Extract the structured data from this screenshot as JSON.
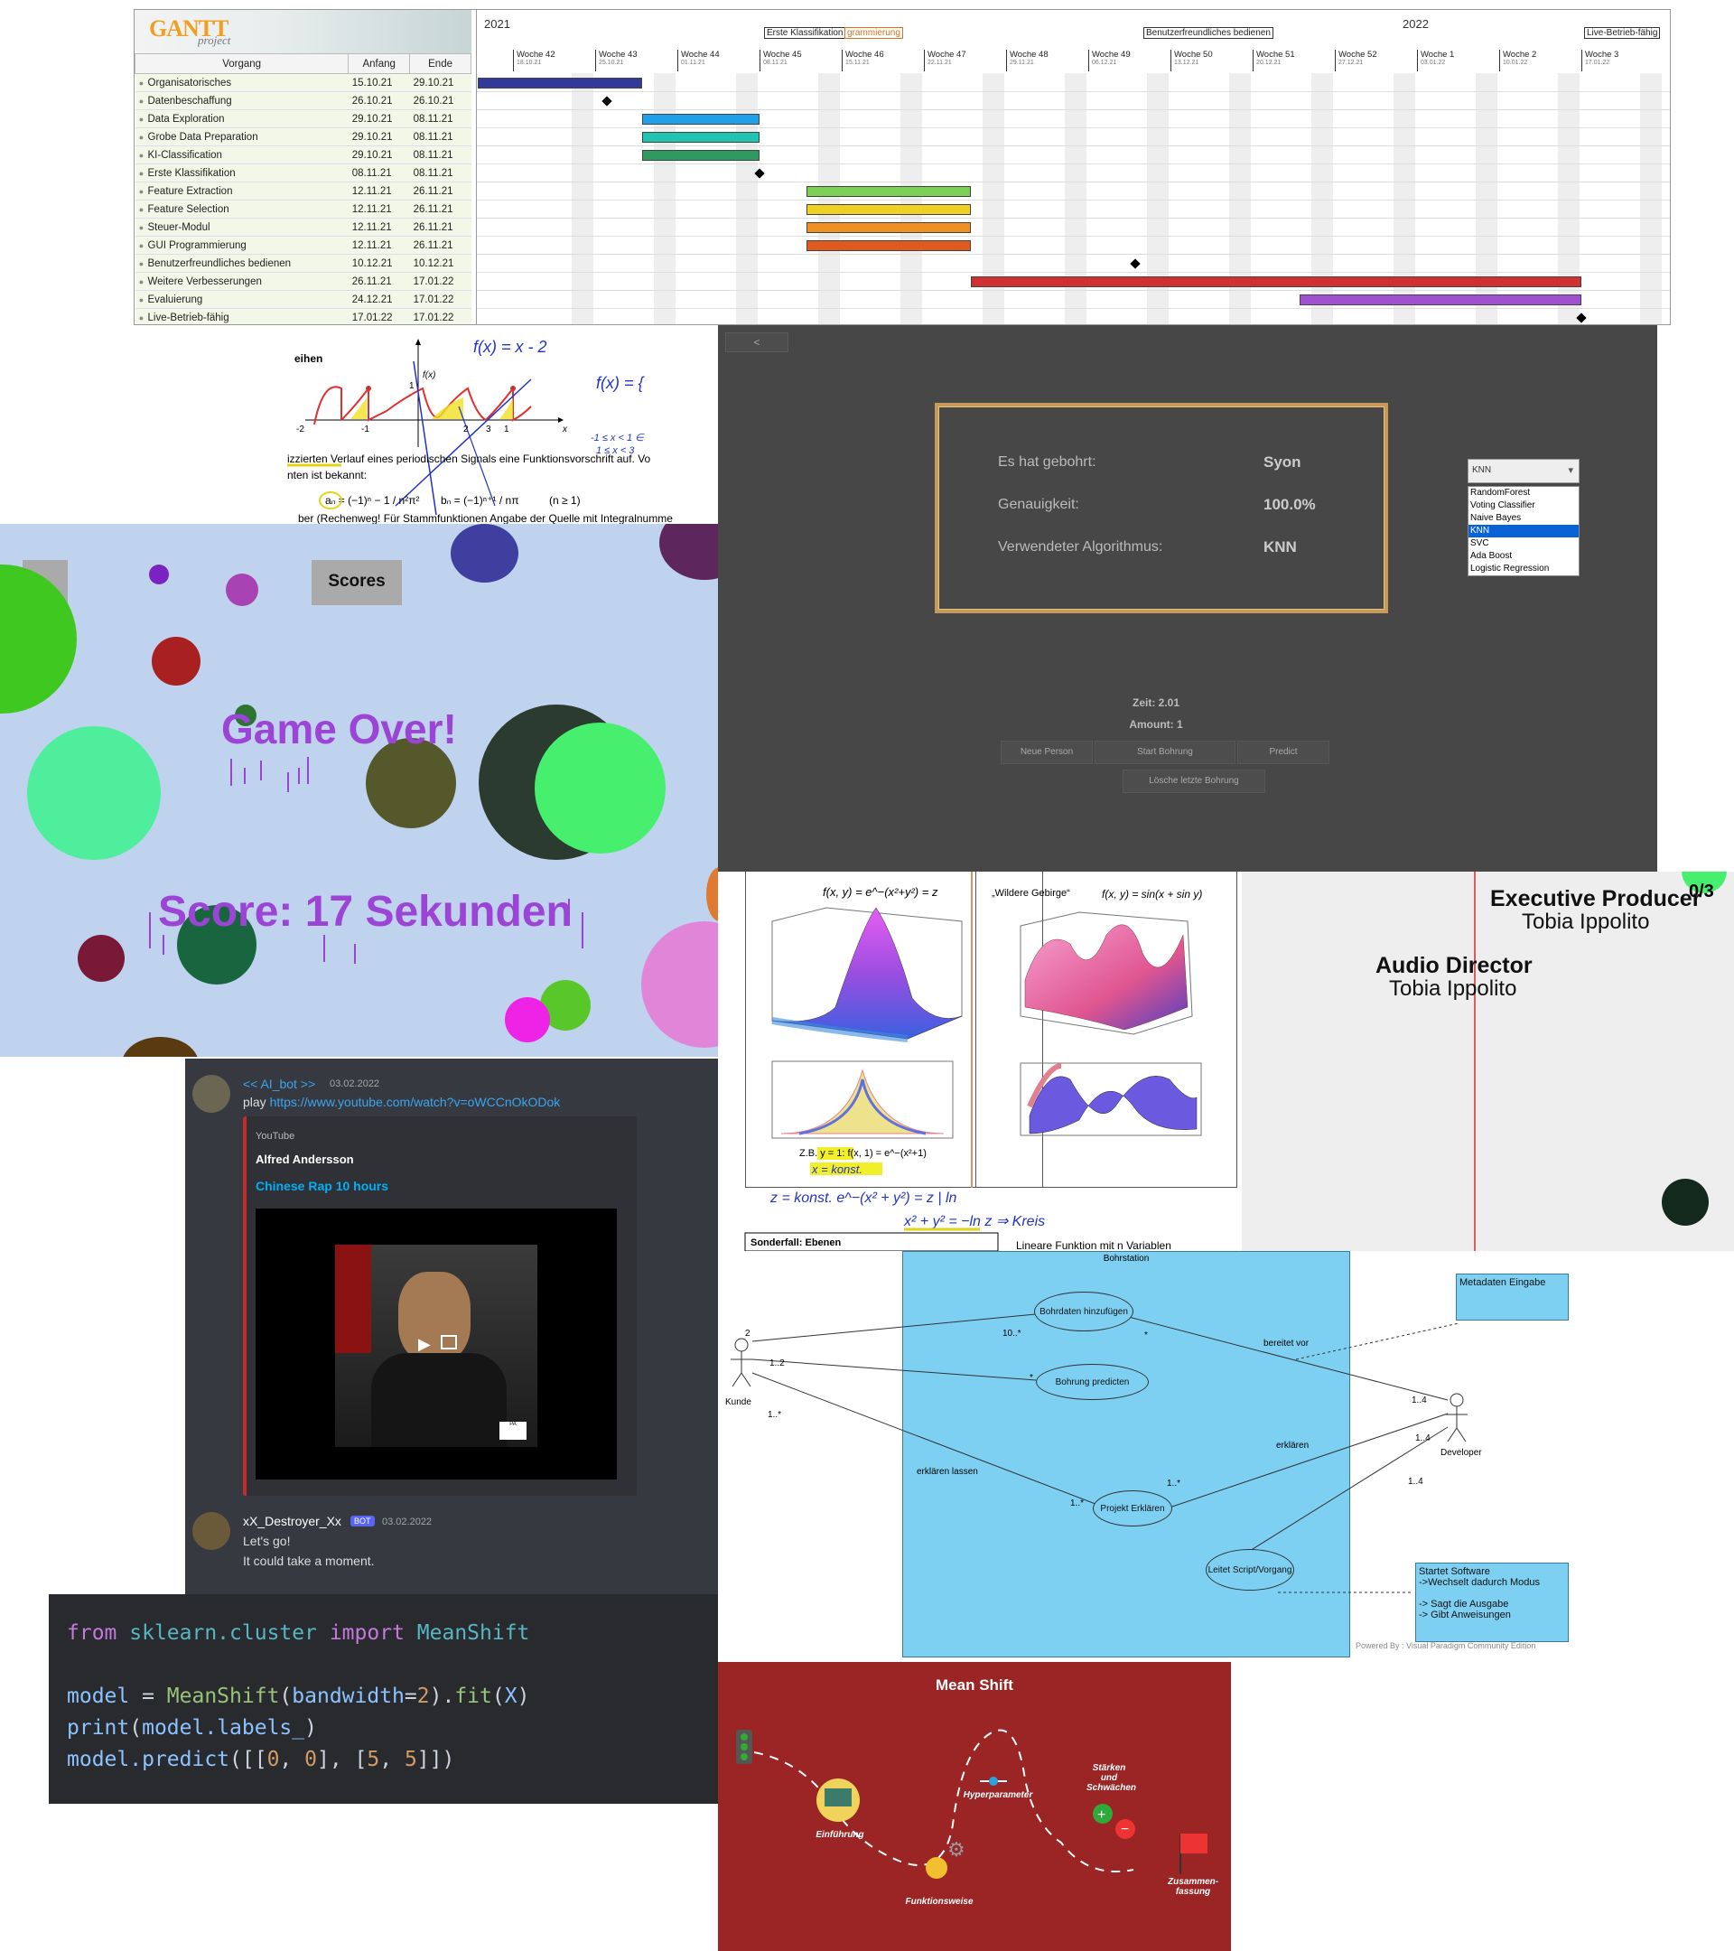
{
  "gantt": {
    "logo_text": "GANTT",
    "logo_sub": "project",
    "headers": [
      "Vorgang",
      "Anfang",
      "Ende"
    ],
    "tasks": [
      {
        "name": "Organisatorisches",
        "start": "15.10.21",
        "end": "29.10.21"
      },
      {
        "name": "Datenbeschaffung",
        "start": "26.10.21",
        "end": "26.10.21"
      },
      {
        "name": "Data Exploration",
        "start": "29.10.21",
        "end": "08.11.21"
      },
      {
        "name": "Grobe Data Preparation",
        "start": "29.10.21",
        "end": "08.11.21"
      },
      {
        "name": "KI-Classification",
        "start": "29.10.21",
        "end": "08.11.21"
      },
      {
        "name": "Erste Klassifikation",
        "start": "08.11.21",
        "end": "08.11.21"
      },
      {
        "name": "Feature Extraction",
        "start": "12.11.21",
        "end": "26.11.21"
      },
      {
        "name": "Feature Selection",
        "start": "12.11.21",
        "end": "26.11.21"
      },
      {
        "name": "Steuer-Modul",
        "start": "12.11.21",
        "end": "26.11.21"
      },
      {
        "name": "GUI Programmierung",
        "start": "12.11.21",
        "end": "26.11.21"
      },
      {
        "name": "Benutzerfreundliches bedienen",
        "start": "10.12.21",
        "end": "10.12.21"
      },
      {
        "name": "Weitere Verbesserungen",
        "start": "26.11.21",
        "end": "17.01.22"
      },
      {
        "name": "Evaluierung",
        "start": "24.12.21",
        "end": "17.01.22"
      },
      {
        "name": "Live-Betrieb-fähig",
        "start": "17.01.22",
        "end": "17.01.22"
      }
    ],
    "years": [
      "2021",
      "2022"
    ],
    "milestones": [
      "Erste Klassifikation",
      "grammierung",
      "Benutzerfreundliches bedienen",
      "Live-Betrieb-fähig"
    ],
    "weeks": [
      {
        "label": "Woche 42",
        "date": "18.10.21"
      },
      {
        "label": "Woche 43",
        "date": "25.10.21"
      },
      {
        "label": "Woche 44",
        "date": "01.11.21"
      },
      {
        "label": "Woche 45",
        "date": "08.11.21"
      },
      {
        "label": "Woche 46",
        "date": "15.11.21"
      },
      {
        "label": "Woche 47",
        "date": "22.11.21"
      },
      {
        "label": "Woche 48",
        "date": "29.11.21"
      },
      {
        "label": "Woche 49",
        "date": "06.12.21"
      },
      {
        "label": "Woche 50",
        "date": "13.12.21"
      },
      {
        "label": "Woche 51",
        "date": "20.12.21"
      },
      {
        "label": "Woche 52",
        "date": "27.12.21"
      },
      {
        "label": "Woche 1",
        "date": "03.01.22"
      },
      {
        "label": "Woche 2",
        "date": "10.01.22"
      },
      {
        "label": "Woche 3",
        "date": "17.01.22"
      }
    ],
    "bar_colors": [
      "#33399a",
      "#4a4ad0",
      "#1fa0e8",
      "#20c4b0",
      "#2e9a60",
      "",
      "#7ccf55",
      "#f0d020",
      "#f09020",
      "#e05a20",
      "",
      "#d03030",
      "#a050d0",
      ""
    ]
  },
  "math1": {
    "heading": "eihen",
    "line1": "izzierten Verlauf eines periodischen Signals eine Funktionsvorschrift auf. Vo",
    "line2": "nten ist bekannt:",
    "line3": "ber (Rechenweg! Für Stammfunktionen Angabe der Quelle mit Integralnumme",
    "hand1": "f(x) = x - 2",
    "hand2": "f(x) = {",
    "hand3": "-1 ≤ x < 1 ∈",
    "hand4": "1 ≤ x < 3",
    "formula_a": "aₙ = (−1)ⁿ − 1 / n²π²",
    "formula_b": "bₙ = (−1)ⁿ⁺¹ / nπ",
    "formula_n": "(n ≥ 1)",
    "fx_label": "f(x)",
    "ticks": [
      "-2",
      "-1",
      "1",
      "2",
      "3",
      "1",
      "-1",
      "x"
    ]
  },
  "mltool": {
    "back_label": "<",
    "result_labels": [
      "Es hat gebohrt:",
      "Genauigkeit:",
      "Verwendeter Algorithmus:"
    ],
    "result_values": [
      "Syon",
      "100.0%",
      "KNN"
    ],
    "dropdown_value": "KNN",
    "options": [
      "RandomForest",
      "Voting Classifier",
      "Naive Bayes",
      "KNN",
      "SVC",
      "Ada Boost",
      "Logistic Regression"
    ],
    "selected_option": "KNN",
    "time": "Zeit: 2.01",
    "amount": "Amount: 1",
    "buttons": [
      "Neue Person",
      "Start Bohrung",
      "Predict"
    ],
    "button_delete": "Lösche letzte Bohrung"
  },
  "game": {
    "scores_button": "Scores",
    "game_over": "Game Over!",
    "score": "Score: 17 Sekunden"
  },
  "math2": {
    "title1": "f(x, y) = e^−(x²+y²) = z",
    "title2": "„Wildere Gebirge“",
    "title3": "f(x, y) = sin(x + sin y)",
    "caption": "Z.B. y = 1: f(x, 1) = e^−(x²+1)",
    "hand1": "x = konst.",
    "hand2": "z = konst.   e^−(x² + y²) = z   | ln",
    "hand3": "x² + y² = −ln z  ⇒ Kreis",
    "box": "Sonderfall: Ebenen",
    "bottom": "Lineare Funktion mit n Variablen"
  },
  "credits": {
    "counter": "0/3",
    "role1": "Executive Producer",
    "name1": "Tobia Ippolito",
    "role2": "Audio Director",
    "name2": "Tobia Ippolito"
  },
  "discord": {
    "msg1_user": "<< AI_bot >>",
    "msg1_time": "03.02.2022",
    "msg1_cmd": "play",
    "msg1_link": "https://www.youtube.com/watch?v=oWCCnOkODok",
    "embed_provider": "YouTube",
    "embed_author": "Alfred Andersson",
    "embed_title": "Chinese Rap 10 hours",
    "msg2_user": "xX_Destroyer_Xx",
    "msg2_badge": "BOT",
    "msg2_time": "03.02.2022",
    "msg2_line1": "Let's go!",
    "msg2_line2": "It could take a moment."
  },
  "code": {
    "line1": [
      "from",
      "sklearn.cluster",
      "import",
      "MeanShift"
    ],
    "line3": [
      "model",
      " = ",
      "MeanShift",
      "(",
      "bandwidth",
      "=",
      "2",
      ").",
      "fit",
      "(",
      "X",
      ")"
    ],
    "line4": [
      "print",
      "(",
      "model.labels_",
      ")"
    ],
    "line5": [
      "model.predict",
      "([[",
      "0",
      ", ",
      "0",
      "], [",
      "5",
      ", ",
      "5",
      "]])"
    ]
  },
  "uml": {
    "system": "Bohrstation",
    "actors": [
      "Kunde",
      "Developer"
    ],
    "usecases": [
      "Bohrdaten hinzufügen",
      "Bohrung predicten",
      "Projekt Erklären",
      "Leitet Script/Vorgang"
    ],
    "note1": "Metadaten Eingabe",
    "note2_lines": [
      "Startet Software",
      "->Wechselt dadurch Modus",
      "",
      "-> Sagt die Ausgabe",
      "-> Gibt Anweisungen"
    ],
    "labels": [
      "2",
      "10..*",
      "1..2",
      "*",
      "1..*",
      "*",
      "bereitet vor",
      "1..4",
      "erklären",
      "1..4",
      "1..4",
      "erklären lassen",
      "1..*",
      "1..*"
    ],
    "footer": "Powered By : Visual Paradigm Community Edition"
  },
  "mean": {
    "title": "Mean Shift",
    "steps": [
      "Einführung",
      "Funktionsweise",
      "Hyperparameter",
      "Stärken und Schwächen",
      "Zusammen-fassung"
    ]
  }
}
